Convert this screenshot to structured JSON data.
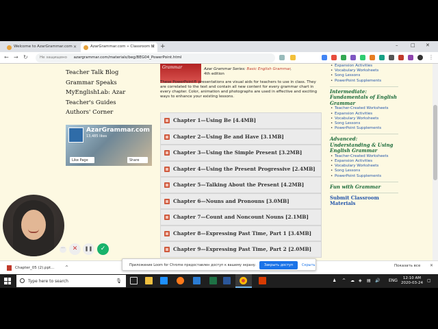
{
  "browser": {
    "tabs": [
      {
        "title": "Welcome to AzarGrammar.com",
        "active": false
      },
      {
        "title": "AzarGrammar.com » Classroom M",
        "active": true
      }
    ],
    "new_tab": "+",
    "window_controls": [
      "–",
      "□",
      "✕"
    ],
    "security_label": "Не защищено",
    "url": "azargrammar.com/materials/beg/BEG04_PowerPoint.html"
  },
  "left_nav": {
    "items": [
      "Teacher Talk Blog",
      "Grammar Speaks",
      "MyEnglishLab: Azar",
      "Teacher's Guides",
      "Authors' Corner"
    ]
  },
  "facebook_widget": {
    "title": "AzarGrammar.com",
    "likes": "13,485 likes",
    "like_button": "Like Page",
    "share_button": "Share"
  },
  "hero": {
    "book_cover_text": "Grammar",
    "series_prefix": "Azar Grammar Series: ",
    "series_title": "Basic English Grammar",
    "edition": "4th edition",
    "description": "These PowerPoint® presentations are visual aids for teachers to use in class. They are correlated to the text and contain all new content for every grammar chart in every chapter. Color, animation and photographs are used in effective and exciting ways to enhance your existing lessons."
  },
  "chapters": [
    "Chapter 1—Using Be [4.4MB]",
    "Chapter 2—Using Be and Have [3.1MB]",
    "Chapter 3—Using the Simple Present [3.2MB]",
    "Chapter 4—Using the Present Progressive [2.4MB]",
    "Chapter 5—Talking About the Present [4.2MB]",
    "Chapter 6—Nouns and Pronouns [3.0MB]",
    "Chapter 7—Count and Noncount Nouns [2.1MB]",
    "Chapter 8—Expressing Past Time, Part 1 [3.4MB]",
    "Chapter 9—Expressing Past Time, Part 2 [2.0MB]"
  ],
  "right_column": {
    "top_items": [
      "Expansion Activities",
      "Vocabulary Worksheets",
      "Song Lessons",
      "PowerPoint Supplements"
    ],
    "intermediate_heading": "Intermediate: Fundamentals of English Grammar",
    "intermediate_items": [
      "Teacher-Created Worksheets",
      "Expansion Activities",
      "Vocabulary Worksheets",
      "Song Lessons",
      "PowerPoint Supplements"
    ],
    "advanced_heading": "Advanced: Understanding & Using English Grammar",
    "advanced_items": [
      "Teacher-Created Worksheets",
      "Expansion Activities",
      "Vocabulary Worksheets",
      "Song Lessons",
      "PowerPoint Supplements"
    ],
    "fun_link": "Fun with Grammar",
    "submit_link": "Submit Classroom Materials"
  },
  "loom": {
    "more": "···",
    "cancel": "✕",
    "pause": "❚❚",
    "done": "✓"
  },
  "download_shelf": {
    "file_name": "Chapter_05 (2).ppt...",
    "chevron": "^",
    "notice_text": "Приложение Loom for Chrome предоставлен доступ к вашему экрану.",
    "stop_button": "Закрыть доступ",
    "hide_button": "Скрыть",
    "show_all": "Показать все",
    "close": "✕"
  },
  "taskbar": {
    "search_placeholder": "Type here to search",
    "lang": "ENG",
    "time": "12:10 AM",
    "date": "2020-03-24"
  },
  "colors": {
    "page_bg": "#fdf9e2",
    "heading_green": "#1a6b3a",
    "link_blue": "#2255aa",
    "loom_green": "#18b36b",
    "accent_blue": "#1a73e8"
  }
}
